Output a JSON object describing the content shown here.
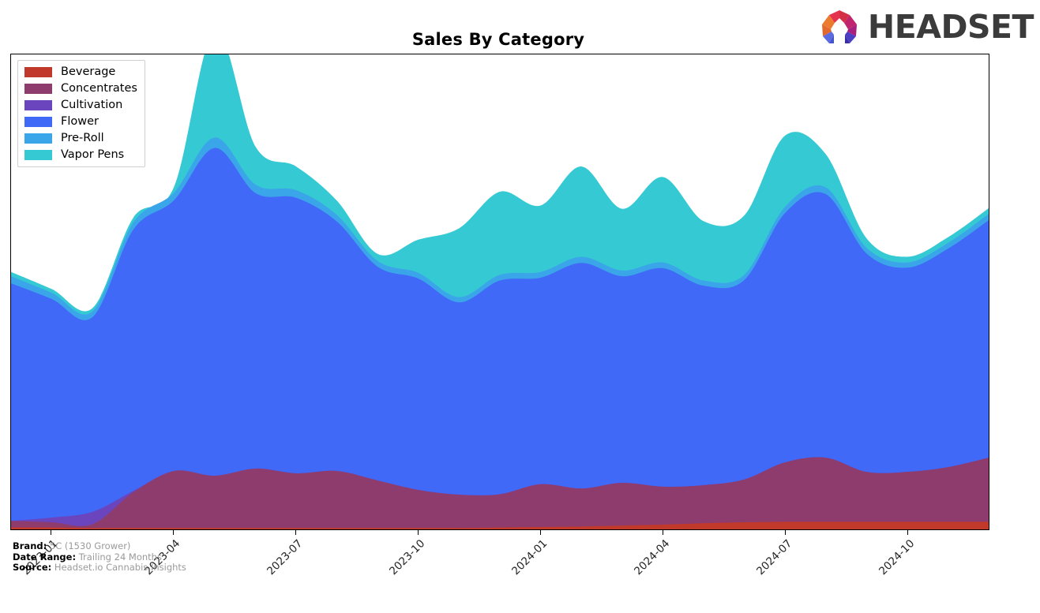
{
  "header": {
    "title": "Sales By Category",
    "logo_wordmark": "HEADSET"
  },
  "footer": {
    "brand_label": "Brand:",
    "brand_value": "5C (1530 Grower)",
    "date_range_label": "Date Range:",
    "date_range_value": "Trailing 24 Months",
    "source_label": "Source:",
    "source_value": "Headset.io Cannabis Insights"
  },
  "chart_data": {
    "type": "area",
    "stacked": true,
    "title": "Sales By Category",
    "xlabel": "",
    "ylabel": "",
    "grid": false,
    "legend_position": "upper left",
    "x_tick_labels": [
      "2023-01",
      "2023-04",
      "2023-07",
      "2023-10",
      "2024-01",
      "2024-04",
      "2024-07",
      "2024-10"
    ],
    "x_tick_positions": [
      0.0417,
      0.1667,
      0.2917,
      0.4167,
      0.5417,
      0.6667,
      0.7917,
      0.9167
    ],
    "x": [
      "2022-11",
      "2022-12",
      "2023-01",
      "2023-02",
      "2023-03",
      "2023-04",
      "2023-05",
      "2023-06",
      "2023-07",
      "2023-08",
      "2023-09",
      "2023-10",
      "2023-11",
      "2023-12",
      "2024-01",
      "2024-02",
      "2024-03",
      "2024-04",
      "2024-05",
      "2024-06",
      "2024-07",
      "2024-08",
      "2024-09",
      "2024-10",
      "2024-11"
    ],
    "ylim": [
      0,
      100
    ],
    "series": [
      {
        "name": "Beverage",
        "color": "#C0392B",
        "values": [
          0.4,
          0.4,
          0.3,
          0.3,
          0.3,
          0.3,
          0.3,
          0.3,
          0.3,
          0.3,
          0.3,
          0.3,
          0.4,
          0.5,
          0.6,
          0.8,
          1.0,
          1.3,
          1.5,
          1.6,
          1.6,
          1.6,
          1.6,
          1.6,
          1.6
        ]
      },
      {
        "name": "Concentrates",
        "color": "#8E3C6E",
        "values": [
          1.4,
          1.1,
          0.8,
          7.5,
          12.0,
          11.0,
          12.5,
          11.5,
          12.0,
          10.0,
          8.0,
          7.0,
          7.0,
          9.0,
          8.0,
          9.0,
          8.0,
          8.0,
          9.0,
          12.5,
          13.5,
          10.5,
          10.5,
          11.5,
          13.5
        ]
      },
      {
        "name": "Cultivation",
        "color": "#6A45BE",
        "values": [
          0.0,
          1.0,
          2.6,
          0.3,
          0.0,
          0.0,
          0.0,
          0.0,
          0.0,
          0.0,
          0.0,
          0.0,
          0.0,
          0.0,
          0.0,
          0.0,
          0.0,
          0.0,
          0.0,
          0.0,
          0.0,
          0.0,
          0.0,
          0.0,
          0.0
        ]
      },
      {
        "name": "Flower",
        "color": "#4169F7",
        "values": [
          50.0,
          46.0,
          41.0,
          55.0,
          57.0,
          69.0,
          58.0,
          58.0,
          52.5,
          45.0,
          44.5,
          40.5,
          45.0,
          43.5,
          47.5,
          43.5,
          46.0,
          42.0,
          42.0,
          52.5,
          55.5,
          46.0,
          43.0,
          46.0,
          50.0
        ]
      },
      {
        "name": "Pre-Roll",
        "color": "#3AA5E8",
        "values": [
          1.5,
          1.3,
          1.2,
          1.5,
          1.6,
          2.2,
          1.8,
          1.6,
          1.4,
          1.2,
          1.2,
          1.1,
          1.2,
          1.2,
          1.3,
          1.2,
          1.2,
          1.1,
          1.1,
          1.3,
          1.4,
          1.2,
          1.1,
          1.2,
          1.3
        ]
      },
      {
        "name": "Vapor Pens",
        "color": "#35C9D4",
        "values": [
          0.9,
          0.8,
          0.7,
          1.0,
          1.2,
          22.5,
          8.0,
          5.0,
          3.0,
          1.5,
          7.0,
          14.5,
          17.5,
          14.0,
          19.0,
          13.0,
          18.0,
          12.5,
          12.5,
          15.0,
          7.0,
          2.0,
          1.2,
          1.2,
          1.2
        ]
      }
    ]
  }
}
